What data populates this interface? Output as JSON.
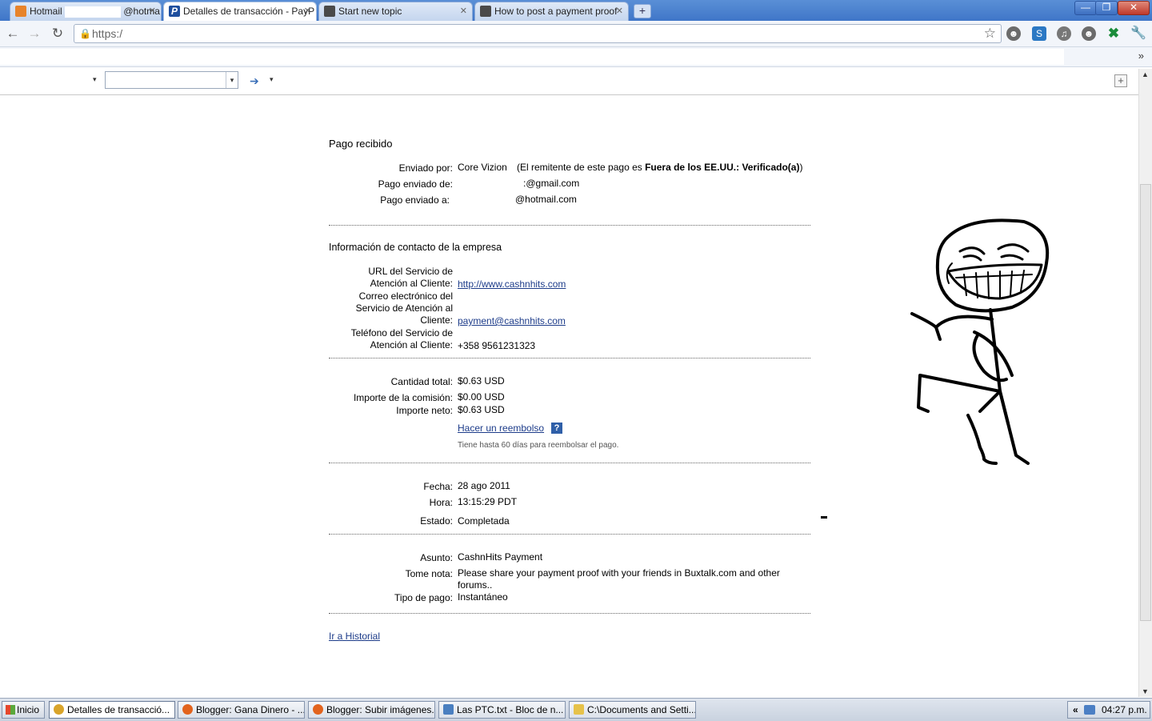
{
  "browser": {
    "tabs": [
      {
        "title": "Hotmail",
        "title_suffix": "@hotma",
        "fav_color": "#e7832a",
        "active": false
      },
      {
        "title": "Detalles de transacción - PayP",
        "fav_color": "#1f4f9e",
        "active": true
      },
      {
        "title": "Start new topic",
        "fav_color": "#4a4a4a",
        "active": false
      },
      {
        "title": "How to post a payment proof",
        "fav_color": "#4a4a4a",
        "active": false
      }
    ],
    "new_tab_symbol": "+",
    "window_controls": {
      "minimize": "—",
      "restore": "❐",
      "close": "✕"
    },
    "url": "https:/",
    "bookmarks_overflow": "»"
  },
  "toolbar2": {
    "dropdown_arrow": "▾",
    "go_symbol": "➔",
    "plus": "+"
  },
  "transaction": {
    "heading": "Pago recibido",
    "sent_by_label": "Enviado por:",
    "sent_by_value": "Core Vizion",
    "sender_note_prefix": "(El remitente de este pago es ",
    "sender_note_bold": "Fuera de los EE.UU.: Verificado(a)",
    "sender_note_suffix": ")",
    "sent_from_label": "Pago enviado de:",
    "sent_from_value": ":@gmail.com",
    "sent_to_label": "Pago enviado a:",
    "sent_to_value": "@hotmail.com"
  },
  "contact": {
    "heading": "Información de contacto de la empresa",
    "url_label": "URL del Servicio de Atención al Cliente:",
    "url_value": "http://www.cashnhits.com",
    "email_label": "Correo electrónico del Servicio de Atención al Cliente:",
    "email_value": "payment@cashnhits.com",
    "phone_label": "Teléfono del Servicio de Atención al Cliente:",
    "phone_value": "+358 9561231323"
  },
  "amounts": {
    "total_label": "Cantidad total:",
    "total_value": "$0.63 USD",
    "fee_label": "Importe de la comisión:",
    "fee_value": "$0.00 USD",
    "net_label": "Importe neto:",
    "net_value": "$0.63 USD",
    "refund_link": "Hacer un reembolso",
    "help_symbol": "?",
    "refund_note": "Tiene hasta 60 días para reembolsar el pago."
  },
  "status": {
    "date_label": "Fecha:",
    "date_value": "28 ago 2011",
    "time_label": "Hora:",
    "time_value": "13:15:29 PDT",
    "state_label": "Estado:",
    "state_value": "Completada"
  },
  "details": {
    "subject_label": "Asunto:",
    "subject_value": "CashnHits Payment",
    "note_label": "Tome nota:",
    "note_value": "Please share your payment proof with your friends in Buxtalk.com and other forums..",
    "type_label": "Tipo de pago:",
    "type_value": "Instantáneo"
  },
  "history_link": "Ir a Historial",
  "taskbar": {
    "start": "Inicio",
    "items": [
      {
        "label": "Detalles de transacció...",
        "icon_color": "#d9a42a",
        "active": true
      },
      {
        "label": "Blogger: Gana Dinero - ...",
        "icon_color": "#e2631d",
        "active": false
      },
      {
        "label": "Blogger: Subir imágenes...",
        "icon_color": "#e2631d",
        "active": false
      },
      {
        "label": "Las  PTC.txt - Bloc de n...",
        "icon_color": "#4a7fc0",
        "active": false
      },
      {
        "label": "C:\\Documents and Setti...",
        "icon_color": "#e6c24a",
        "active": false
      }
    ],
    "tray_chevron": "«",
    "clock": "04:27 p.m."
  },
  "colors": {
    "link": "#1d3c8a",
    "paypal_blue": "#1f4f9e"
  }
}
